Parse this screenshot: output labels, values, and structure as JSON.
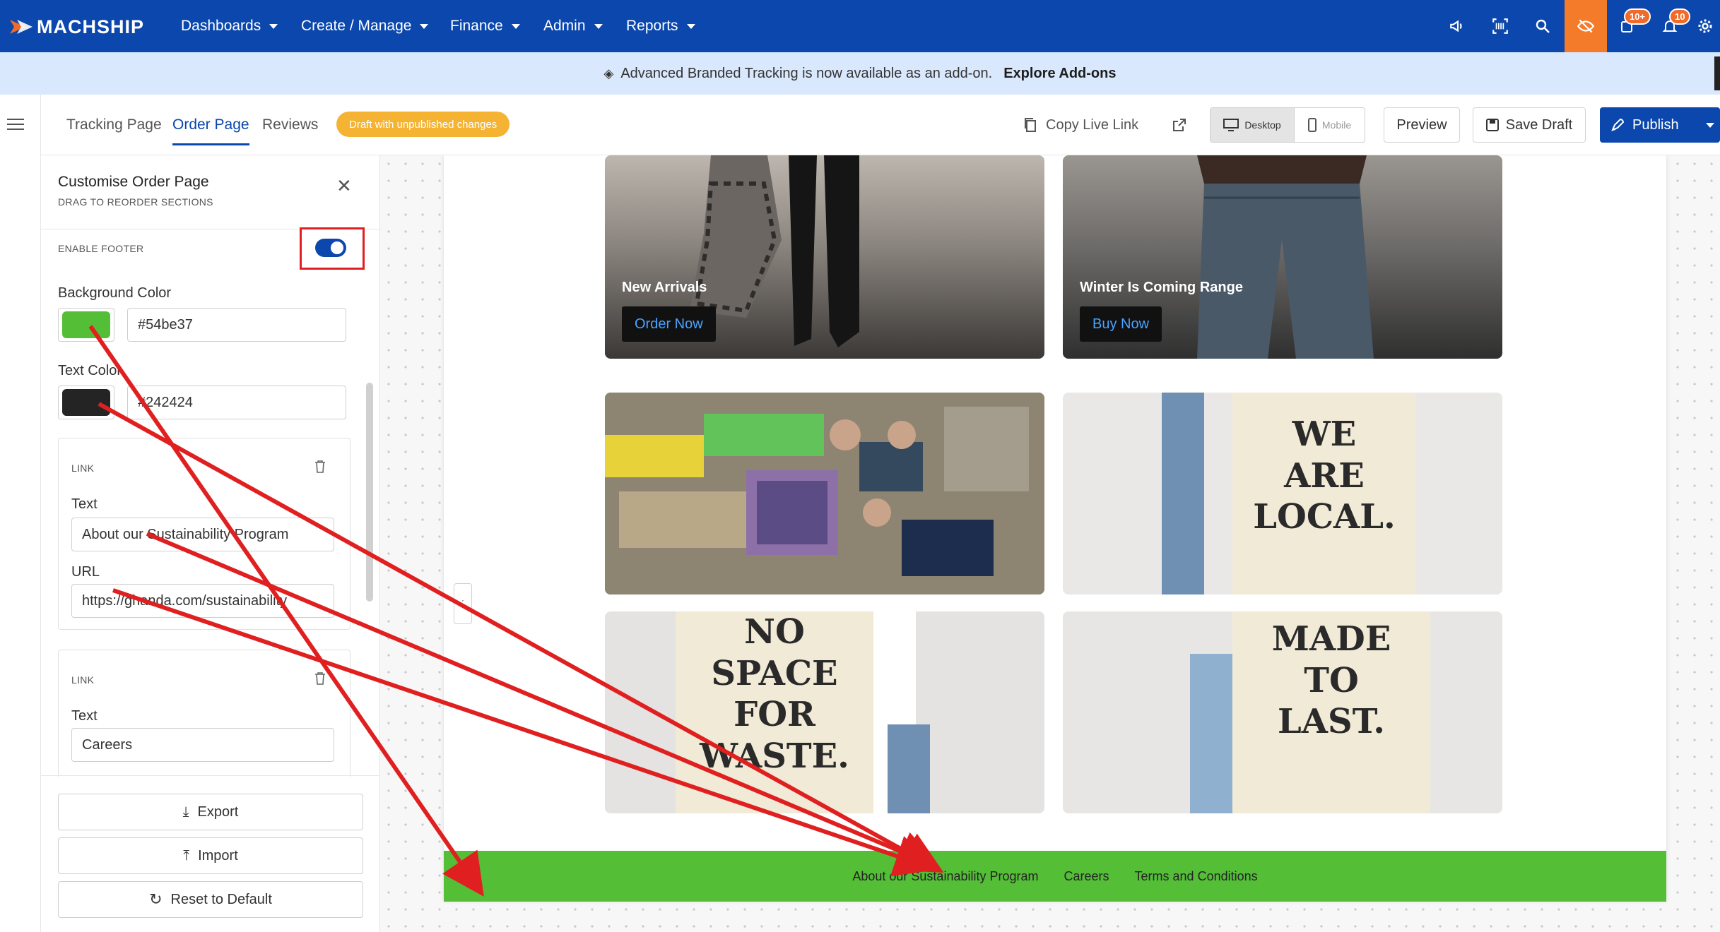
{
  "brand": {
    "name": "MACHSHIP",
    "color": "#0b47ad"
  },
  "nav": {
    "items": [
      "Dashboards",
      "Create / Manage",
      "Finance",
      "Admin",
      "Reports"
    ]
  },
  "top_icons": {
    "notifications_badge": "10+",
    "alerts_badge": "10"
  },
  "announcement": {
    "text": "Advanced Branded Tracking is now available as an add-on.",
    "link": "Explore Add-ons"
  },
  "toolbar": {
    "tabs": [
      "Tracking Page",
      "Order Page",
      "Reviews"
    ],
    "active_tab": "Order Page",
    "draft_badge": "Draft with unpublished changes",
    "copy_link": "Copy Live Link",
    "device_desktop": "Desktop",
    "device_mobile": "Mobile",
    "preview": "Preview",
    "save_draft": "Save Draft",
    "publish": "Publish"
  },
  "panel": {
    "title": "Customise Order Page",
    "subtitle": "DRAG TO REORDER SECTIONS",
    "enable_footer_label": "ENABLE FOOTER",
    "enable_footer": true,
    "background_color_label": "Background Color",
    "background_color": "#54be37",
    "text_color_label": "Text Color",
    "text_color": "#242424",
    "links": [
      {
        "section": "LINK",
        "text_label": "Text",
        "text": "About our Sustainability Program",
        "url_label": "URL",
        "url": "https://ghanda.com/sustainability"
      },
      {
        "section": "LINK",
        "text_label": "Text",
        "text": "Careers"
      }
    ],
    "export": "Export",
    "import": "Import",
    "reset": "Reset to Default"
  },
  "preview": {
    "tiles": [
      {
        "caption": "New Arrivals",
        "button": "Order Now"
      },
      {
        "caption": "Winter Is Coming Range",
        "button": "Buy Now"
      }
    ],
    "posters": [
      "WE ARE LOCAL.",
      "NO SPACE FOR WASTE.",
      "MADE TO LAST."
    ],
    "footer_links": [
      "About our Sustainability Program",
      "Careers",
      "Terms and Conditions"
    ],
    "footer_bg": "#54be37",
    "footer_text": "#242424"
  }
}
